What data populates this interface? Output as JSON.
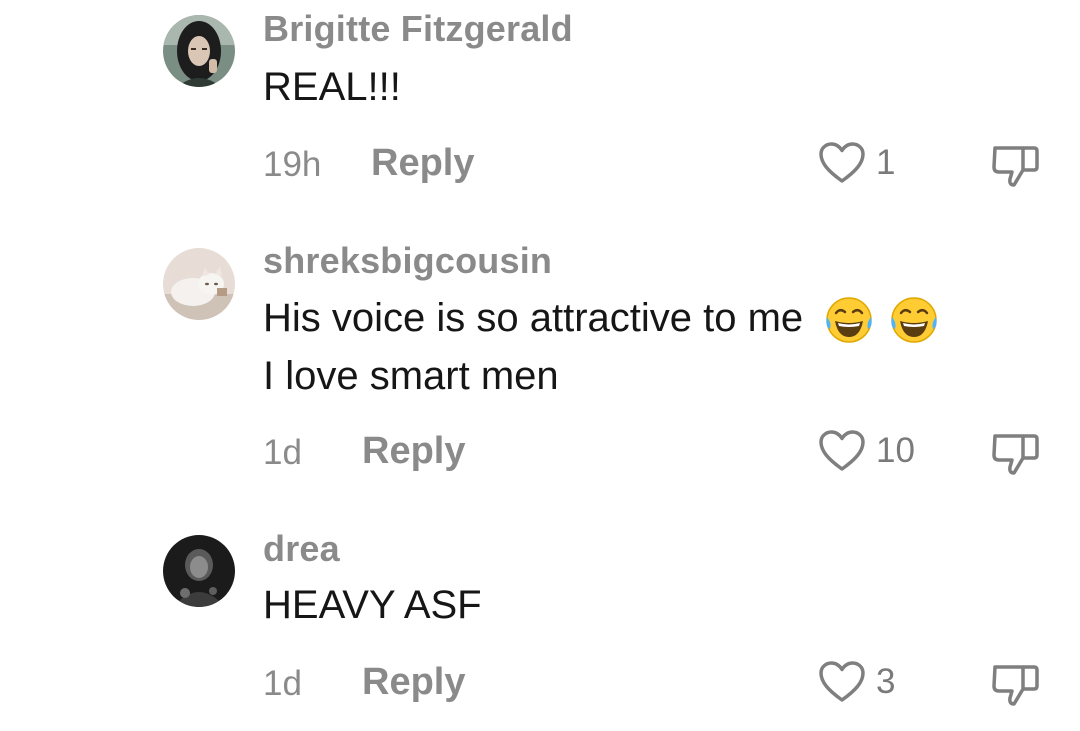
{
  "comments": [
    {
      "username": "Brigitte Fitzgerald",
      "text_lines": [
        "REAL!!!"
      ],
      "time": "19h",
      "reply_label": "Reply",
      "like_count": "1",
      "avatar_icon": "avatar-dark-hair-person"
    },
    {
      "username": "shreksbigcousin",
      "text_lines": [
        "His voice is so attractive to me",
        "I love smart men"
      ],
      "emojis": [
        "face-with-tears-of-joy",
        "face-with-tears-of-joy"
      ],
      "time": "1d",
      "reply_label": "Reply",
      "like_count": "10",
      "avatar_icon": "avatar-white-cat"
    },
    {
      "username": "drea",
      "text_lines": [
        "HEAVY ASF"
      ],
      "time": "1d",
      "reply_label": "Reply",
      "like_count": "3",
      "avatar_icon": "avatar-dark-figure"
    }
  ],
  "icons": {
    "like": "heart-outline-icon",
    "dislike": "thumbs-down-outline-icon"
  },
  "colors": {
    "text": "#161616",
    "secondary": "#8a8a8a",
    "background": "#ffffff"
  }
}
